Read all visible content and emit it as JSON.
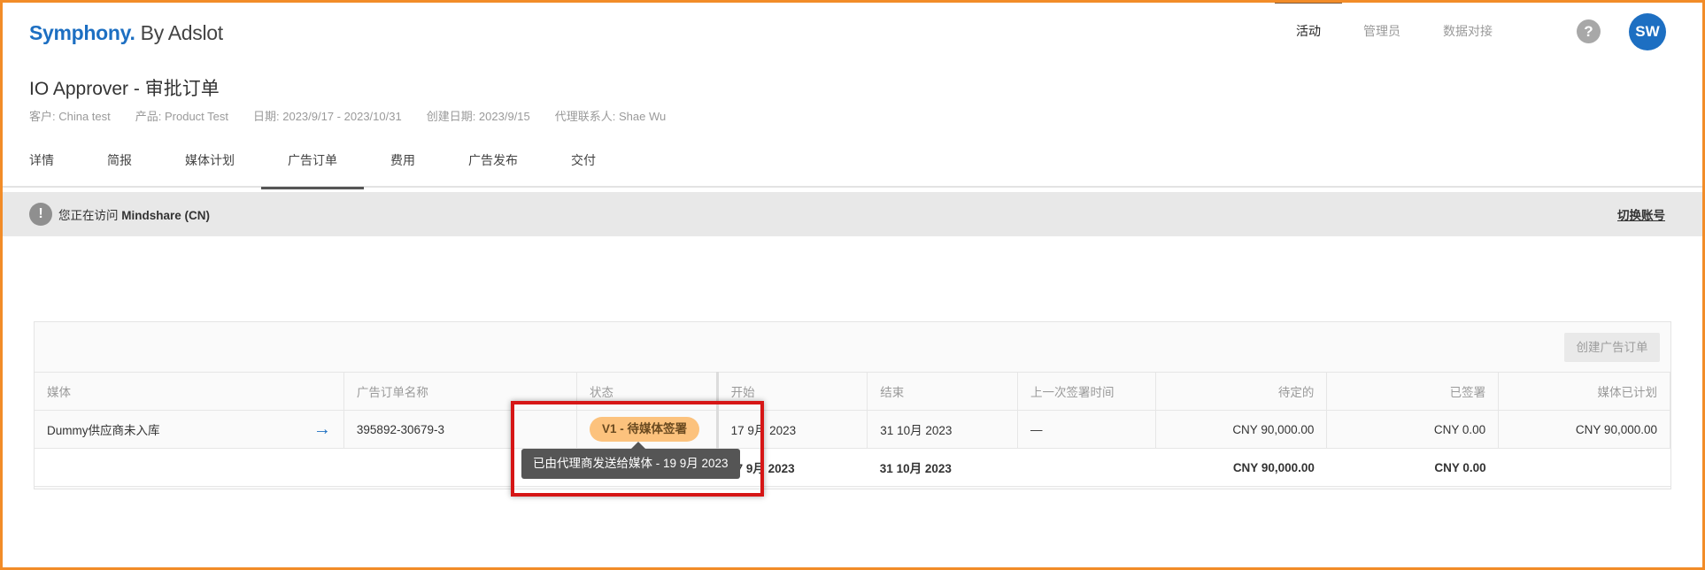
{
  "header": {
    "brand": "Symphony.",
    "brand_suffix": " By Adslot",
    "nav": [
      {
        "label": "活动"
      },
      {
        "label": "管理员"
      },
      {
        "label": "数据对接"
      }
    ],
    "help_label": "?",
    "avatar_initials": "SW"
  },
  "page": {
    "title": "IO Approver - 审批订单",
    "meta": [
      "客户: China test",
      "产品: Product Test",
      "日期: 2023/9/17 - 2023/10/31",
      "创建日期: 2023/9/15",
      "代理联系人: Shae Wu"
    ]
  },
  "tabs": [
    {
      "label": "详情"
    },
    {
      "label": "简报"
    },
    {
      "label": "媒体计划"
    },
    {
      "label": "广告订单"
    },
    {
      "label": "费用"
    },
    {
      "label": "广告发布"
    },
    {
      "label": "交付"
    }
  ],
  "banner": {
    "icon": "!",
    "text_prefix": "您正在访问 ",
    "account": "Mindshare (CN)",
    "switch_label": "切换账号"
  },
  "orders": {
    "create_button": "创建广告订单",
    "columns": [
      "媒体",
      "广告订单名称",
      "状态",
      "开始",
      "结束",
      "上一次签署时间",
      "待定的",
      "已签署",
      "媒体已计划"
    ],
    "row": {
      "media": "Dummy供应商未入库",
      "order_name": "395892-30679-3",
      "status": "V1 - 待媒体签署",
      "start": "17 9月 2023",
      "end": "31 10月 2023",
      "last_signed": "—",
      "pending": "CNY 90,000.00",
      "signed": "CNY 0.00",
      "planned": "CNY 90,000.00"
    },
    "total": {
      "start": "17 9月 2023",
      "end": "31 10月 2023",
      "pending": "CNY 90,000.00",
      "signed": "CNY 0.00"
    },
    "tooltip": "已由代理商发送给媒体 - 19 9月 2023"
  },
  "colors": {
    "brand": "#1d6fc2",
    "status_badge": "#fcc27d",
    "highlight": "#d61616",
    "frame": "#f28c28"
  }
}
